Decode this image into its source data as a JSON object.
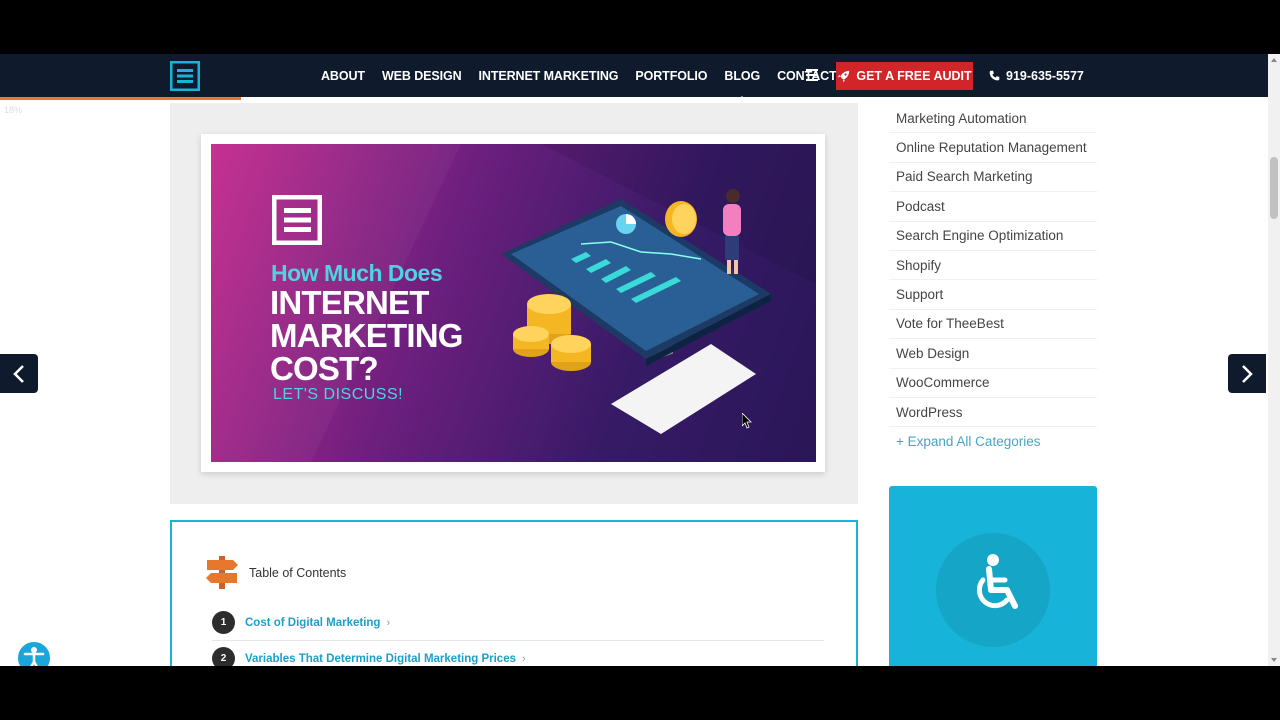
{
  "nav": {
    "links": [
      {
        "label": "ABOUT"
      },
      {
        "label": "WEB DESIGN"
      },
      {
        "label": "INTERNET MARKETING"
      },
      {
        "label": "PORTFOLIO"
      },
      {
        "label": "BLOG",
        "active": true
      },
      {
        "label": "CONTACT"
      }
    ],
    "cta_label": "GET A FREE AUDIT",
    "phone": "919-635-5577"
  },
  "reading_progress": {
    "text": "18%",
    "value": 0.18
  },
  "featured_image": {
    "line1": "How Much Does",
    "line2": "INTERNET",
    "line3": "MARKETING",
    "line4": "COST?",
    "line5": "LET'S DISCUSS!"
  },
  "toc": {
    "title": "Table of Contents",
    "items": [
      {
        "num": "1",
        "label": "Cost of Digital Marketing"
      },
      {
        "num": "2",
        "label": "Variables That Determine Digital Marketing Prices"
      }
    ]
  },
  "sidebar": {
    "categories": [
      "Marketing Automation",
      "Online Reputation Management",
      "Paid Search Marketing",
      "Podcast",
      "Search Engine Optimization",
      "Shopify",
      "Support",
      "Vote for TheeBest",
      "Web Design",
      "WooCommerce",
      "WordPress"
    ],
    "expand_label": "+ Expand All Categories"
  },
  "colors": {
    "nav_bg": "#0f1b2d",
    "cta_bg": "#d1252a",
    "accent": "#17b3d8",
    "link": "#1d9fc7"
  },
  "icons": [
    "logo-icon",
    "menu-icon",
    "rocket-icon",
    "phone-icon",
    "signpost-icon",
    "wheelchair-icon",
    "chevron-left-icon",
    "chevron-right-icon",
    "accessibility-icon"
  ]
}
